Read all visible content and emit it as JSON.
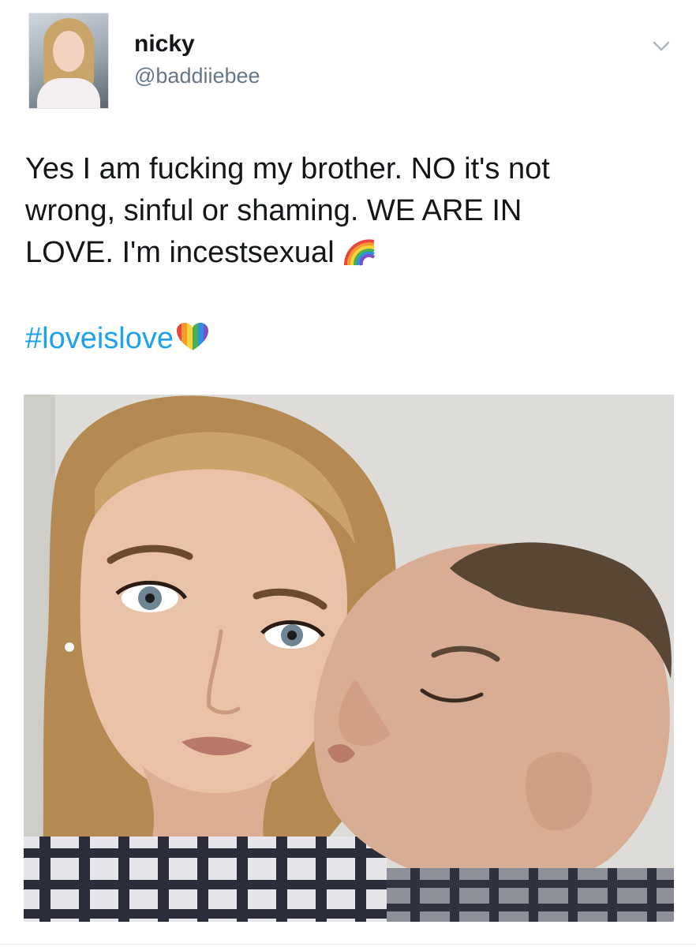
{
  "tweet": {
    "author": {
      "display_name": "nicky",
      "handle": "@baddiiebee",
      "avatar_icon": "profile-photo"
    },
    "menu_icon": "chevron-down-icon",
    "text_lines": [
      "Yes I am fucking my brother. NO it's not",
      "wrong, sinful or shaming. WE ARE IN",
      "LOVE. I'm incestsexual"
    ],
    "text_emoji": "rainbow-emoji",
    "hashtag": "#loveislove",
    "hashtag_emoji": "rainbow-heart-emoji",
    "photo": {
      "icon": "selfie-photo"
    }
  },
  "colors": {
    "text": "#14171a",
    "muted": "#657786",
    "link": "#1da1f2",
    "border": "#e1e8ed"
  }
}
